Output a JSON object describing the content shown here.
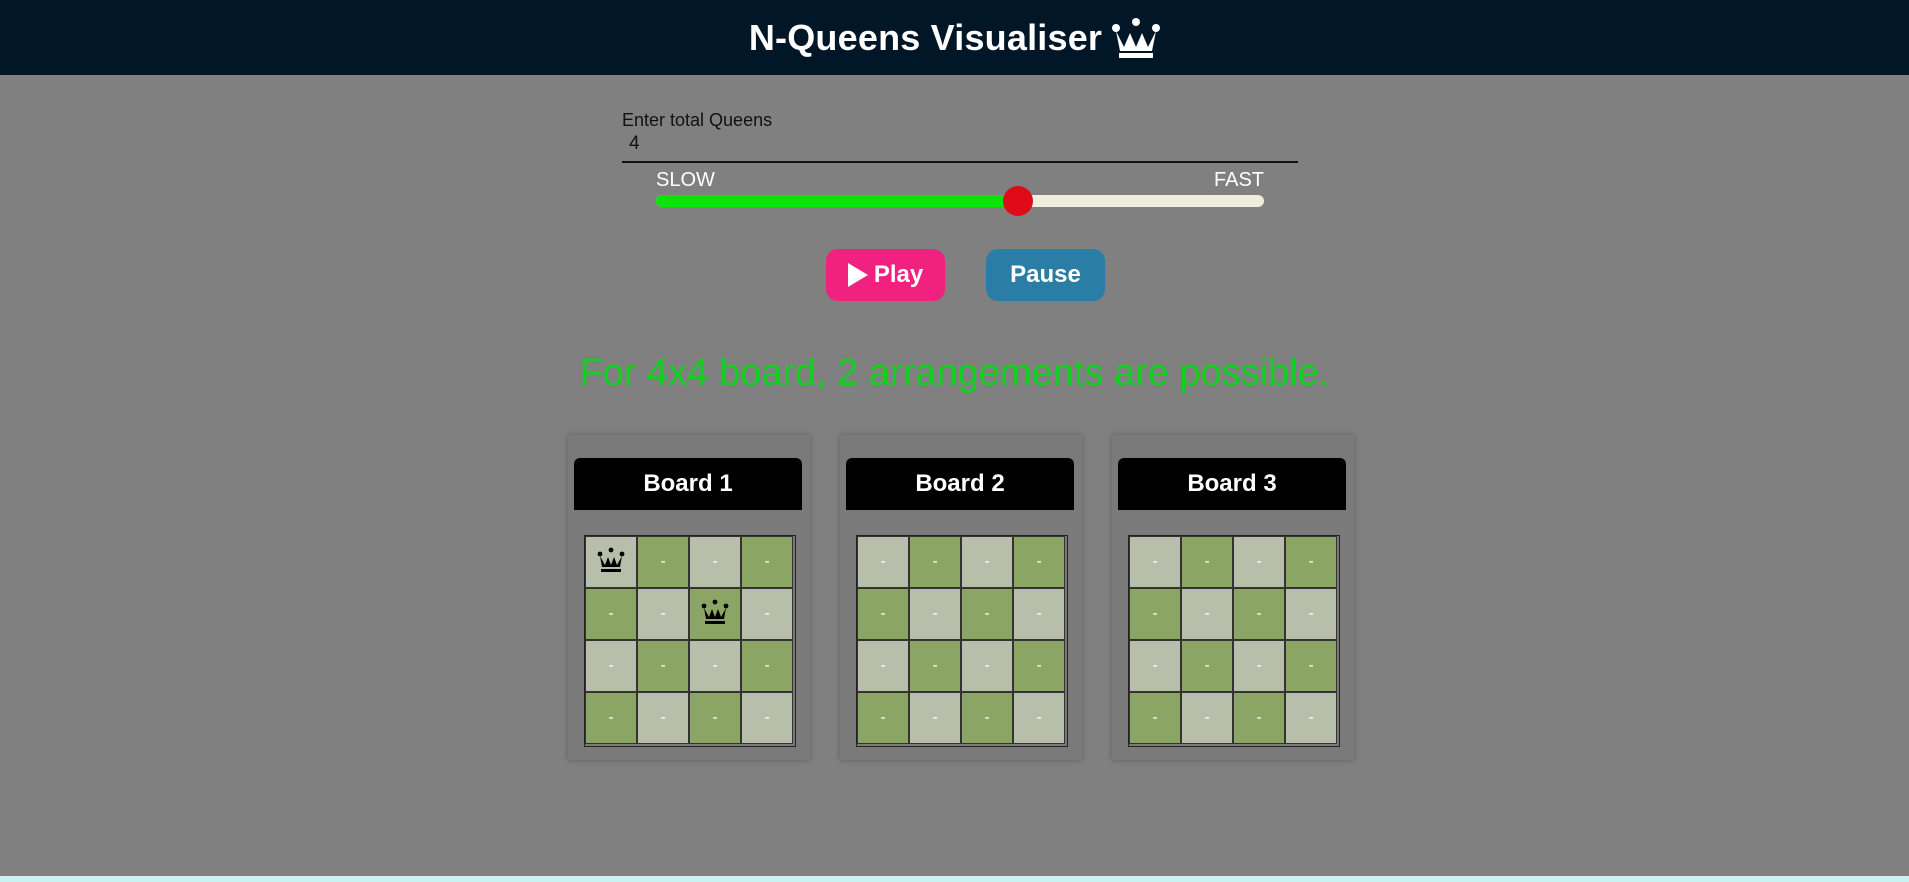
{
  "header": {
    "title": "N-Queens Visualiser",
    "icon": "crown-icon"
  },
  "controls": {
    "queens_label": "Enter total Queens",
    "queens_value": "4",
    "speed_slow_label": "SLOW",
    "speed_fast_label": "FAST",
    "speed_value_fraction": 0.595,
    "play_label": "Play",
    "pause_label": "Pause"
  },
  "result_text": "For 4x4 board, 2 arrangements are possible.",
  "colors": {
    "header_bg": "#011627",
    "play_bg": "#f0217f",
    "pause_bg": "#2a7ea6",
    "result_text": "#11d11e",
    "slider_fill": "#0be10b",
    "slider_thumb": "#e00b18",
    "cell_light": "#b7bfaa",
    "cell_dark": "#8ba664"
  },
  "boards": [
    {
      "title": "Board 1",
      "cells": [
        [
          "Q",
          "-",
          "-",
          "-"
        ],
        [
          "-",
          "-",
          "Q",
          "-"
        ],
        [
          "-",
          "-",
          "-",
          "-"
        ],
        [
          "-",
          "-",
          "-",
          "-"
        ]
      ]
    },
    {
      "title": "Board 2",
      "cells": [
        [
          "-",
          "-",
          "-",
          "-"
        ],
        [
          "-",
          "-",
          "-",
          "-"
        ],
        [
          "-",
          "-",
          "-",
          "-"
        ],
        [
          "-",
          "-",
          "-",
          "-"
        ]
      ]
    },
    {
      "title": "Board 3",
      "cells": [
        [
          "-",
          "-",
          "-",
          "-"
        ],
        [
          "-",
          "-",
          "-",
          "-"
        ],
        [
          "-",
          "-",
          "-",
          "-"
        ],
        [
          "-",
          "-",
          "-",
          "-"
        ]
      ]
    }
  ]
}
